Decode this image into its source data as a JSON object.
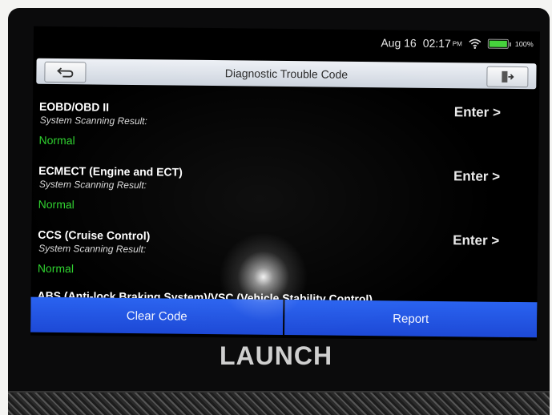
{
  "status": {
    "date": "Aug 16",
    "time": "02:17",
    "ampm": "PM",
    "battery_pct": "100%",
    "battery_level": 1.0
  },
  "header": {
    "title": "Diagnostic Trouble Code"
  },
  "systems": [
    {
      "name": "EOBD/OBD II",
      "result_label": "System Scanning Result:",
      "result": "Normal",
      "action": "Enter >"
    },
    {
      "name": "ECMECT (Engine and ECT)",
      "result_label": "System Scanning Result:",
      "result": "Normal",
      "action": "Enter >"
    },
    {
      "name": "CCS (Cruise Control)",
      "result_label": "System Scanning Result:",
      "result": "Normal",
      "action": "Enter >"
    },
    {
      "name": "ABS (Anti-lock Braking System)/VSC (Vehicle Stability Control)"
    }
  ],
  "footer": {
    "clear_code": "Clear Code",
    "report": "Report"
  },
  "brand": "LAUNCH",
  "colors": {
    "accent_blue": "#2a63f0",
    "normal_green": "#2fd12f",
    "battery_green": "#46d23c"
  }
}
